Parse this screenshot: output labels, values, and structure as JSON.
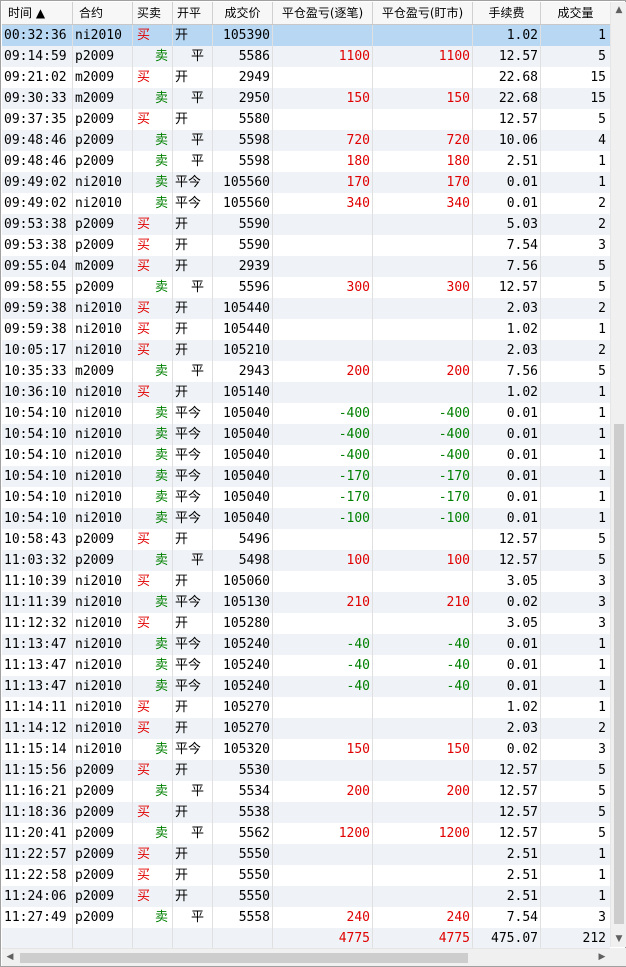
{
  "columns": [
    "时间",
    "合约",
    "买卖",
    "开平",
    "成交价",
    "平仓盈亏(逐笔)",
    "平仓盈亏(盯市)",
    "手续费",
    "成交量"
  ],
  "sort_indicator": "▲",
  "rows": [
    {
      "time": "00:32:36",
      "contract": "ni2010",
      "side": "买",
      "oc": "开",
      "price": "105390",
      "pnl1": "",
      "pnl2": "",
      "fee": "1.02",
      "qty": "1"
    },
    {
      "time": "09:14:59",
      "contract": "p2009",
      "side": "卖",
      "oc": "平",
      "price": "5586",
      "pnl1": "1100",
      "pnl2": "1100",
      "fee": "12.57",
      "qty": "5"
    },
    {
      "time": "09:21:02",
      "contract": "m2009",
      "side": "买",
      "oc": "开",
      "price": "2949",
      "pnl1": "",
      "pnl2": "",
      "fee": "22.68",
      "qty": "15"
    },
    {
      "time": "09:30:33",
      "contract": "m2009",
      "side": "卖",
      "oc": "平",
      "price": "2950",
      "pnl1": "150",
      "pnl2": "150",
      "fee": "22.68",
      "qty": "15"
    },
    {
      "time": "09:37:35",
      "contract": "p2009",
      "side": "买",
      "oc": "开",
      "price": "5580",
      "pnl1": "",
      "pnl2": "",
      "fee": "12.57",
      "qty": "5"
    },
    {
      "time": "09:48:46",
      "contract": "p2009",
      "side": "卖",
      "oc": "平",
      "price": "5598",
      "pnl1": "720",
      "pnl2": "720",
      "fee": "10.06",
      "qty": "4"
    },
    {
      "time": "09:48:46",
      "contract": "p2009",
      "side": "卖",
      "oc": "平",
      "price": "5598",
      "pnl1": "180",
      "pnl2": "180",
      "fee": "2.51",
      "qty": "1"
    },
    {
      "time": "09:49:02",
      "contract": "ni2010",
      "side": "卖",
      "oc": "平今",
      "price": "105560",
      "pnl1": "170",
      "pnl2": "170",
      "fee": "0.01",
      "qty": "1"
    },
    {
      "time": "09:49:02",
      "contract": "ni2010",
      "side": "卖",
      "oc": "平今",
      "price": "105560",
      "pnl1": "340",
      "pnl2": "340",
      "fee": "0.01",
      "qty": "2"
    },
    {
      "time": "09:53:38",
      "contract": "p2009",
      "side": "买",
      "oc": "开",
      "price": "5590",
      "pnl1": "",
      "pnl2": "",
      "fee": "5.03",
      "qty": "2"
    },
    {
      "time": "09:53:38",
      "contract": "p2009",
      "side": "买",
      "oc": "开",
      "price": "5590",
      "pnl1": "",
      "pnl2": "",
      "fee": "7.54",
      "qty": "3"
    },
    {
      "time": "09:55:04",
      "contract": "m2009",
      "side": "买",
      "oc": "开",
      "price": "2939",
      "pnl1": "",
      "pnl2": "",
      "fee": "7.56",
      "qty": "5"
    },
    {
      "time": "09:58:55",
      "contract": "p2009",
      "side": "卖",
      "oc": "平",
      "price": "5596",
      "pnl1": "300",
      "pnl2": "300",
      "fee": "12.57",
      "qty": "5"
    },
    {
      "time": "09:59:38",
      "contract": "ni2010",
      "side": "买",
      "oc": "开",
      "price": "105440",
      "pnl1": "",
      "pnl2": "",
      "fee": "2.03",
      "qty": "2"
    },
    {
      "time": "09:59:38",
      "contract": "ni2010",
      "side": "买",
      "oc": "开",
      "price": "105440",
      "pnl1": "",
      "pnl2": "",
      "fee": "1.02",
      "qty": "1"
    },
    {
      "time": "10:05:17",
      "contract": "ni2010",
      "side": "买",
      "oc": "开",
      "price": "105210",
      "pnl1": "",
      "pnl2": "",
      "fee": "2.03",
      "qty": "2"
    },
    {
      "time": "10:35:33",
      "contract": "m2009",
      "side": "卖",
      "oc": "平",
      "price": "2943",
      "pnl1": "200",
      "pnl2": "200",
      "fee": "7.56",
      "qty": "5"
    },
    {
      "time": "10:36:10",
      "contract": "ni2010",
      "side": "买",
      "oc": "开",
      "price": "105140",
      "pnl1": "",
      "pnl2": "",
      "fee": "1.02",
      "qty": "1"
    },
    {
      "time": "10:54:10",
      "contract": "ni2010",
      "side": "卖",
      "oc": "平今",
      "price": "105040",
      "pnl1": "-400",
      "pnl2": "-400",
      "fee": "0.01",
      "qty": "1"
    },
    {
      "time": "10:54:10",
      "contract": "ni2010",
      "side": "卖",
      "oc": "平今",
      "price": "105040",
      "pnl1": "-400",
      "pnl2": "-400",
      "fee": "0.01",
      "qty": "1"
    },
    {
      "time": "10:54:10",
      "contract": "ni2010",
      "side": "卖",
      "oc": "平今",
      "price": "105040",
      "pnl1": "-400",
      "pnl2": "-400",
      "fee": "0.01",
      "qty": "1"
    },
    {
      "time": "10:54:10",
      "contract": "ni2010",
      "side": "卖",
      "oc": "平今",
      "price": "105040",
      "pnl1": "-170",
      "pnl2": "-170",
      "fee": "0.01",
      "qty": "1"
    },
    {
      "time": "10:54:10",
      "contract": "ni2010",
      "side": "卖",
      "oc": "平今",
      "price": "105040",
      "pnl1": "-170",
      "pnl2": "-170",
      "fee": "0.01",
      "qty": "1"
    },
    {
      "time": "10:54:10",
      "contract": "ni2010",
      "side": "卖",
      "oc": "平今",
      "price": "105040",
      "pnl1": "-100",
      "pnl2": "-100",
      "fee": "0.01",
      "qty": "1"
    },
    {
      "time": "10:58:43",
      "contract": "p2009",
      "side": "买",
      "oc": "开",
      "price": "5496",
      "pnl1": "",
      "pnl2": "",
      "fee": "12.57",
      "qty": "5"
    },
    {
      "time": "11:03:32",
      "contract": "p2009",
      "side": "卖",
      "oc": "平",
      "price": "5498",
      "pnl1": "100",
      "pnl2": "100",
      "fee": "12.57",
      "qty": "5"
    },
    {
      "time": "11:10:39",
      "contract": "ni2010",
      "side": "买",
      "oc": "开",
      "price": "105060",
      "pnl1": "",
      "pnl2": "",
      "fee": "3.05",
      "qty": "3"
    },
    {
      "time": "11:11:39",
      "contract": "ni2010",
      "side": "卖",
      "oc": "平今",
      "price": "105130",
      "pnl1": "210",
      "pnl2": "210",
      "fee": "0.02",
      "qty": "3"
    },
    {
      "time": "11:12:32",
      "contract": "ni2010",
      "side": "买",
      "oc": "开",
      "price": "105280",
      "pnl1": "",
      "pnl2": "",
      "fee": "3.05",
      "qty": "3"
    },
    {
      "time": "11:13:47",
      "contract": "ni2010",
      "side": "卖",
      "oc": "平今",
      "price": "105240",
      "pnl1": "-40",
      "pnl2": "-40",
      "fee": "0.01",
      "qty": "1"
    },
    {
      "time": "11:13:47",
      "contract": "ni2010",
      "side": "卖",
      "oc": "平今",
      "price": "105240",
      "pnl1": "-40",
      "pnl2": "-40",
      "fee": "0.01",
      "qty": "1"
    },
    {
      "time": "11:13:47",
      "contract": "ni2010",
      "side": "卖",
      "oc": "平今",
      "price": "105240",
      "pnl1": "-40",
      "pnl2": "-40",
      "fee": "0.01",
      "qty": "1"
    },
    {
      "time": "11:14:11",
      "contract": "ni2010",
      "side": "买",
      "oc": "开",
      "price": "105270",
      "pnl1": "",
      "pnl2": "",
      "fee": "1.02",
      "qty": "1"
    },
    {
      "time": "11:14:12",
      "contract": "ni2010",
      "side": "买",
      "oc": "开",
      "price": "105270",
      "pnl1": "",
      "pnl2": "",
      "fee": "2.03",
      "qty": "2"
    },
    {
      "time": "11:15:14",
      "contract": "ni2010",
      "side": "卖",
      "oc": "平今",
      "price": "105320",
      "pnl1": "150",
      "pnl2": "150",
      "fee": "0.02",
      "qty": "3"
    },
    {
      "time": "11:15:56",
      "contract": "p2009",
      "side": "买",
      "oc": "开",
      "price": "5530",
      "pnl1": "",
      "pnl2": "",
      "fee": "12.57",
      "qty": "5"
    },
    {
      "time": "11:16:21",
      "contract": "p2009",
      "side": "卖",
      "oc": "平",
      "price": "5534",
      "pnl1": "200",
      "pnl2": "200",
      "fee": "12.57",
      "qty": "5"
    },
    {
      "time": "11:18:36",
      "contract": "p2009",
      "side": "买",
      "oc": "开",
      "price": "5538",
      "pnl1": "",
      "pnl2": "",
      "fee": "12.57",
      "qty": "5"
    },
    {
      "time": "11:20:41",
      "contract": "p2009",
      "side": "卖",
      "oc": "平",
      "price": "5562",
      "pnl1": "1200",
      "pnl2": "1200",
      "fee": "12.57",
      "qty": "5"
    },
    {
      "time": "11:22:57",
      "contract": "p2009",
      "side": "买",
      "oc": "开",
      "price": "5550",
      "pnl1": "",
      "pnl2": "",
      "fee": "2.51",
      "qty": "1"
    },
    {
      "time": "11:22:58",
      "contract": "p2009",
      "side": "买",
      "oc": "开",
      "price": "5550",
      "pnl1": "",
      "pnl2": "",
      "fee": "2.51",
      "qty": "1"
    },
    {
      "time": "11:24:06",
      "contract": "p2009",
      "side": "买",
      "oc": "开",
      "price": "5550",
      "pnl1": "",
      "pnl2": "",
      "fee": "2.51",
      "qty": "1"
    },
    {
      "time": "11:27:49",
      "contract": "p2009",
      "side": "卖",
      "oc": "平",
      "price": "5558",
      "pnl1": "240",
      "pnl2": "240",
      "fee": "7.54",
      "qty": "3"
    }
  ],
  "totals": {
    "time": "",
    "contract": "",
    "side": "",
    "oc": "",
    "price": "",
    "pnl1": "4775",
    "pnl2": "4775",
    "fee": "475.07",
    "qty": "212"
  },
  "selected_row_index": 0,
  "colors": {
    "buy": "#e00000",
    "sell": "#008000",
    "selected": "#b7d7f3",
    "alt_row": "#eff3f7"
  }
}
